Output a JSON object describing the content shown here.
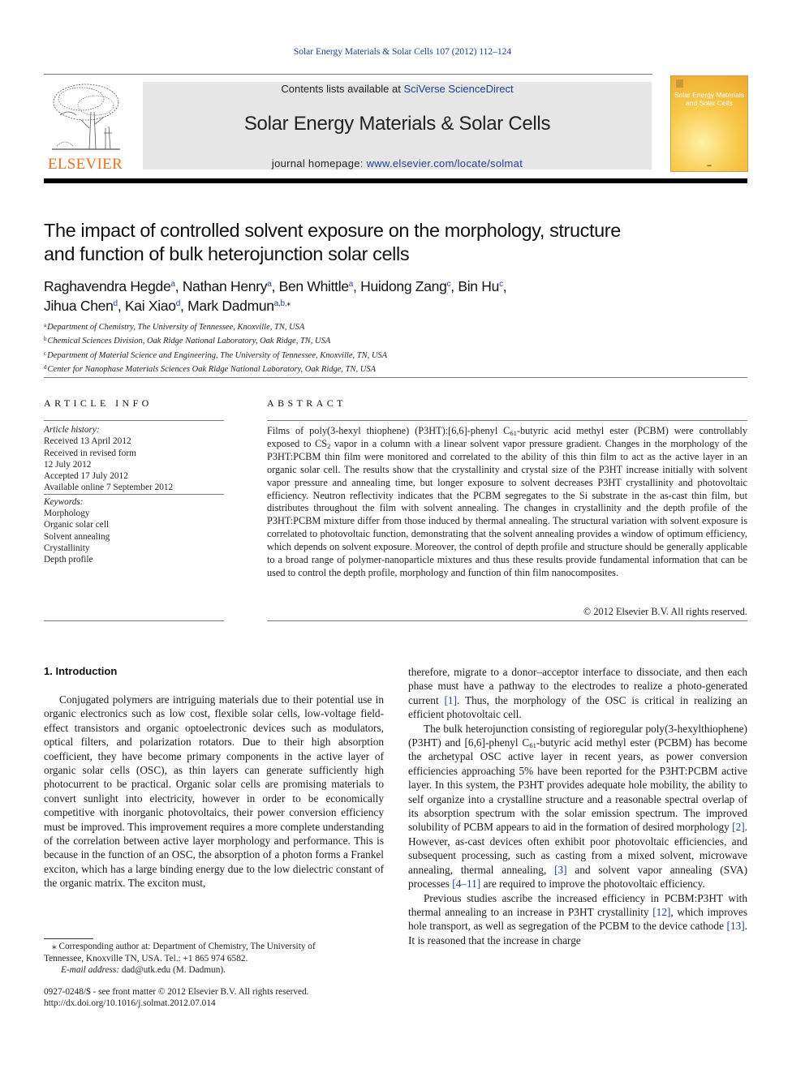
{
  "running_head": "Solar Energy Materials & Solar Cells 107 (2012) 112–124",
  "masthead": {
    "contents_prefix": "Contents lists available at ",
    "contents_link": "SciVerse ScienceDirect",
    "journal_title": "Solar Energy Materials & Solar Cells",
    "homepage_prefix": "journal homepage: ",
    "homepage_link": "www.elsevier.com/locate/solmat",
    "publisher_logo_text": "ELSEVIER",
    "publisher_logo_icon": "tree-engraving-icon",
    "cover_title": "Solar Energy Materials and Solar Cells",
    "colors": {
      "link": "#1f3f93",
      "logo_orange": "#e9711c",
      "masthead_bg": "#e6e6e6"
    }
  },
  "article": {
    "title_line1": "The impact of controlled solvent exposure on the morphology, structure",
    "title_line2": "and function of bulk heterojunction solar cells",
    "authors": [
      {
        "name": "Raghavendra Hegde",
        "aff": "a",
        "sep": ", "
      },
      {
        "name": "Nathan Henry",
        "aff": "a",
        "sep": ", "
      },
      {
        "name": "Ben Whittle",
        "aff": "a",
        "sep": ", "
      },
      {
        "name": "Huidong Zang",
        "aff": "c",
        "sep": ", "
      },
      {
        "name": "Bin Hu",
        "aff": "c",
        "sep": ","
      },
      {
        "name": "Jihua Chen",
        "aff": "d",
        "sep": ", "
      },
      {
        "name": "Kai Xiao",
        "aff": "d",
        "sep": ", "
      },
      {
        "name": "Mark Dadmun",
        "aff": "a,b,",
        "sep": ""
      }
    ],
    "corresponding_mark": "⁎",
    "affiliations": [
      {
        "key": "a",
        "text": "Department of Chemistry, The University of Tennessee, Knoxville, TN, USA"
      },
      {
        "key": "b",
        "text": "Chemical Sciences Division, Oak Ridge National Laboratory, Oak Ridge, TN, USA"
      },
      {
        "key": "c",
        "text": "Department of Material Science and Engineering, The University of Tennessee, Knoxville, TN, USA"
      },
      {
        "key": "d",
        "text": "Center for Nanophase Materials Sciences Oak Ridge National Laboratory, Oak Ridge, TN, USA"
      }
    ]
  },
  "article_info": {
    "heading": "ARTICLE INFO",
    "history_label": "Article history:",
    "history": [
      "Received 13 April 2012",
      "Received in revised form",
      "12 July 2012",
      "Accepted 17 July 2012",
      "Available online 7 September 2012"
    ],
    "keywords_label": "Keywords:",
    "keywords": [
      "Morphology",
      "Organic solar cell",
      "Solvent annealing",
      "Crystallinity",
      "Depth profile"
    ]
  },
  "abstract": {
    "heading": "ABSTRACT",
    "p1": "Films of poly(3-hexyl thiophene) (P3HT):[6,6]-phenyl C",
    "p1_sub": "61",
    "p2": "-butyric acid methyl ester (PCBM) were controllably exposed to CS",
    "p2_sub": "2",
    "p3": " vapor in a column with a linear solvent vapor pressure gradient. Changes in the morphology of the P3HT:PCBM thin film were monitored and correlated to the ability of this thin film to act as the active layer in an organic solar cell. The results show that the crystallinity and crystal size of the P3HT increase initially with solvent vapor pressure and annealing time, but longer exposure to solvent decreases P3HT crystallinity and photovoltaic efficiency. Neutron reflectivity indicates that the PCBM segregates to the Si substrate in the as-cast thin film, but distributes throughout the film with solvent annealing. The changes in crystallinity and the depth profile of the P3HT:PCBM mixture differ from those induced by thermal annealing. The structural variation with solvent exposure is correlated to photovoltaic function, demonstrating that the solvent annealing provides a window of optimum efficiency, which depends on solvent exposure. Moreover, the control of depth profile and structure should be generally applicable to a broad range of polymer-nanoparticle mixtures and thus these results provide fundamental information that can be used to control the depth profile, morphology and function of thin film nanocomposites.",
    "copyright": "© 2012 Elsevier B.V. All rights reserved."
  },
  "body": {
    "section_heading": "1.  Introduction",
    "left_p1": "Conjugated polymers are intriguing materials due to their potential use in organic electronics such as low cost, flexible solar cells, low-voltage field-effect transistors and organic optoelectronic devices such as modulators, optical filters, and polarization rotators. Due to their high absorption coefficient, they have become primary components in the active layer of organic solar cells (OSC), as thin layers can generate sufficiently high photocurrent to be practical. Organic solar cells are promising materials to convert sunlight into electricity, however in order to be economically competitive with inorganic photovoltaics, their power conversion efficiency must be improved. This improvement requires a more complete understanding of the correlation between active layer morphology and performance. This is because in the function of an OSC, the absorption of a photon forms a Frankel exciton, which has a large binding energy due to the low dielectric constant of the organic matrix. The exciton must,",
    "right_p1a": "therefore, migrate to a donor–acceptor interface to dissociate, and then each phase must have a pathway to the electrodes to realize a photo-generated current ",
    "ref1": "[1]",
    "right_p1b": ". Thus, the morphology of the OSC is critical in realizing an efficient photovoltaic cell.",
    "right_p2a": "The bulk heterojunction consisting of regioregular poly(3-hexylthiophene) (P3HT) and [6,6]-phenyl C",
    "right_p2_sub": "61",
    "right_p2b": "-butyric acid methyl ester (PCBM) has become the archetypal OSC active layer in recent years, as power conversion efficiencies approaching 5% have been reported for the P3HT:PCBM active layer. In this system, the P3HT provides adequate hole mobility, the ability to self organize into a crystalline structure and a reasonable spectral overlap of its absorption spectrum with the solar emission spectrum. The improved solubility of PCBM appears to aid in the formation of desired morphology ",
    "ref2": "[2]",
    "right_p2c": ". However, as-cast devices often exhibit poor photovoltaic efficiencies, and subsequent processing, such as casting from a mixed solvent, microwave annealing, thermal annealing, ",
    "ref3": "[3]",
    "right_p2d": " and solvent vapor annealing (SVA) processes ",
    "ref4_11": "[4–11]",
    "right_p2e": " are required to improve the photovoltaic efficiency.",
    "right_p3a": "Previous studies ascribe the increased efficiency in PCBM:P3HT with thermal annealing to an increase in P3HT crystallinity ",
    "ref12": "[12]",
    "right_p3b": ", which improves hole transport, as well as segregation of the PCBM to the device cathode ",
    "ref13": "[13]",
    "right_p3c": ". It is reasoned that the increase in charge"
  },
  "footnotes": {
    "corresponding_line1": "⁎ Corresponding author at: Department of Chemistry, The University of",
    "corresponding_line2": "Tennessee, Knoxville TN, USA. Tel.: +1 865 974 6582.",
    "email_label": "E-mail address:",
    "email": " dad@utk.edu (M. Dadmun).",
    "issn": "0927-0248/$ - see front matter © 2012 Elsevier B.V. All rights reserved.",
    "doi": "http://dx.doi.org/10.1016/j.solmat.2012.07.014"
  }
}
